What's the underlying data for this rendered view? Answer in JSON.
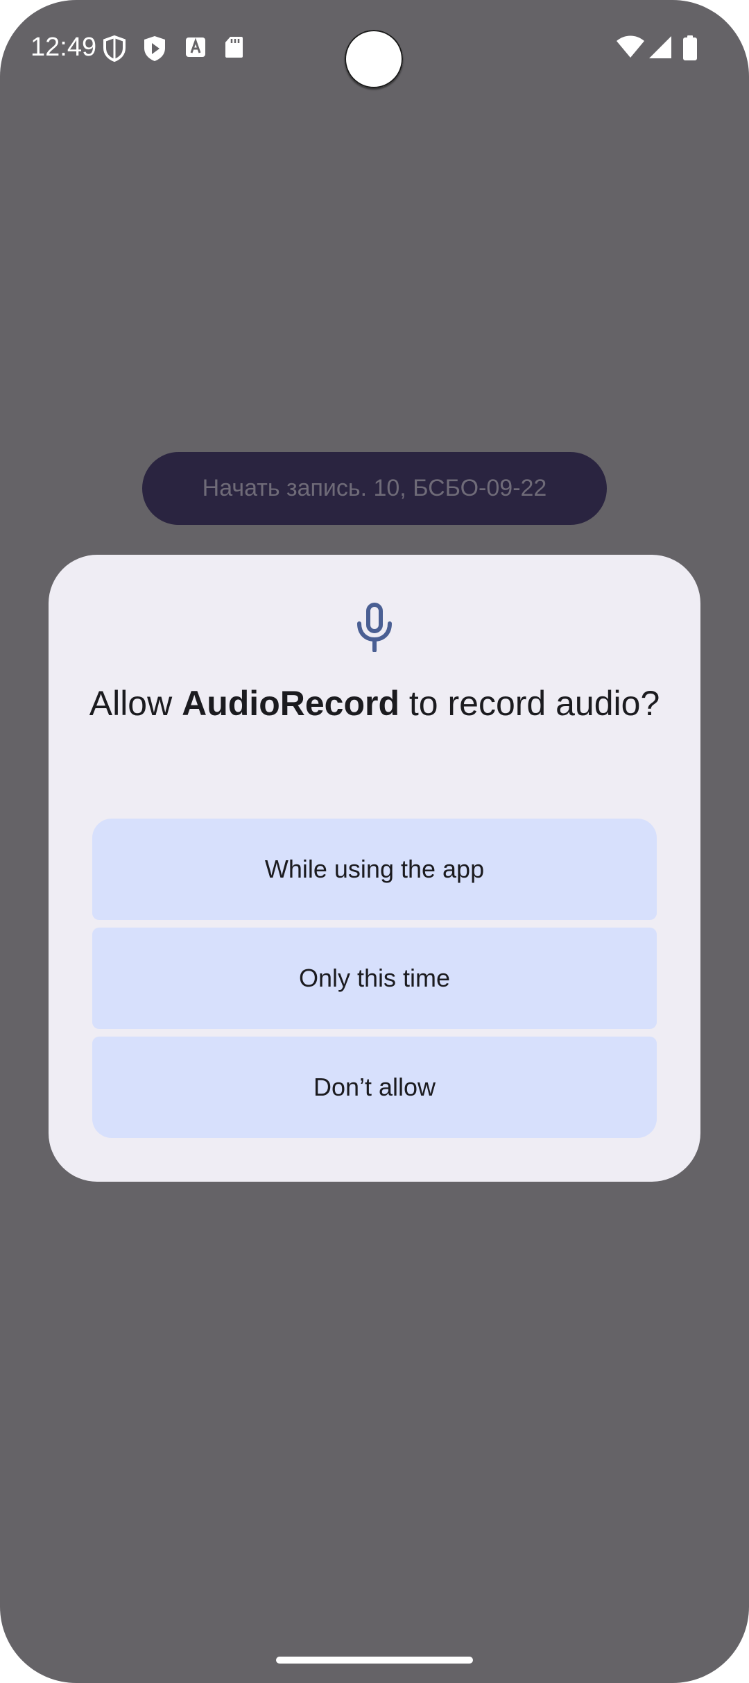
{
  "status_bar": {
    "time": "12:49",
    "left_icons": [
      "shield-icon",
      "play-protect-icon",
      "font-a-icon",
      "sd-card-icon"
    ],
    "right_icons": [
      "wifi-icon",
      "cell-signal-icon",
      "battery-icon"
    ]
  },
  "app": {
    "record_button_label": "Начать запись. 10, БСБО-09-22"
  },
  "dialog": {
    "icon": "microphone-icon",
    "title_prefix": "Allow ",
    "app_name": "AudioRecord",
    "title_suffix": " to record audio?",
    "options": [
      {
        "label": "While using the app"
      },
      {
        "label": "Only this time"
      },
      {
        "label": "Don’t allow"
      }
    ]
  },
  "colors": {
    "scrim": "#656367",
    "dialog_bg": "#efedf4",
    "option_bg": "#d7e0fc",
    "icon_accent": "#4a5f93",
    "app_button_bg": "#2a2440"
  }
}
